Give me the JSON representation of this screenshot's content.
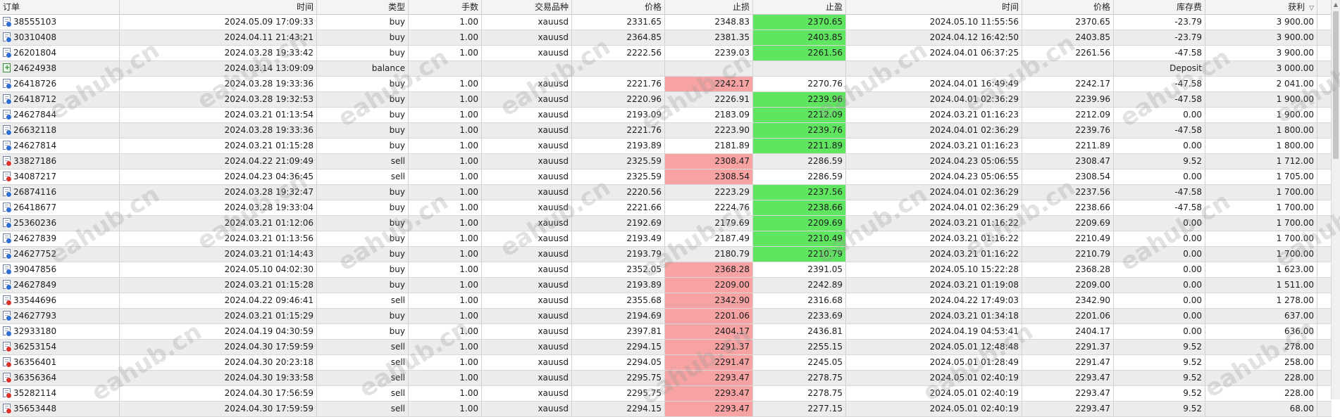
{
  "headers": {
    "order": "订单",
    "time": "时间",
    "type": "类型",
    "lots": "手数",
    "symbol": "交易品种",
    "price": "价格",
    "sl": "止损",
    "tp": "止盈",
    "close_time": "时间",
    "close_price": "价格",
    "swap": "库存费",
    "profit": "获利"
  },
  "watermark": "eahub.cn",
  "colors": {
    "tp_hit": "#5fe55f",
    "sl_hit": "#f7a3a3"
  },
  "rows": [
    {
      "order": "38555103",
      "time": "2024.05.09 17:09:33",
      "type": "buy",
      "lots": "1.00",
      "symbol": "xauusd",
      "price": "2331.65",
      "sl": "2348.83",
      "tp": "2370.65",
      "close_time": "2024.05.10 11:55:56",
      "close_price": "2370.65",
      "swap": "-23.79",
      "profit": "3 900.00",
      "hit": "tp"
    },
    {
      "order": "30310408",
      "time": "2024.04.11 21:43:21",
      "type": "buy",
      "lots": "1.00",
      "symbol": "xauusd",
      "price": "2364.85",
      "sl": "2381.35",
      "tp": "2403.85",
      "close_time": "2024.04.12 16:42:50",
      "close_price": "2403.85",
      "swap": "-23.79",
      "profit": "3 900.00",
      "hit": "tp"
    },
    {
      "order": "26201804",
      "time": "2024.03.28 19:33:42",
      "type": "buy",
      "lots": "1.00",
      "symbol": "xauusd",
      "price": "2222.56",
      "sl": "2239.03",
      "tp": "2261.56",
      "close_time": "2024.04.01 06:37:25",
      "close_price": "2261.56",
      "swap": "-47.58",
      "profit": "3 900.00",
      "hit": "tp"
    },
    {
      "order": "24624938",
      "time": "2024.03.14 13:09:09",
      "type": "balance",
      "lots": "",
      "symbol": "",
      "price": "",
      "sl": "",
      "tp": "",
      "close_time": "",
      "close_price": "",
      "swap": "Deposit",
      "profit": "3 000.00",
      "hit": ""
    },
    {
      "order": "26418726",
      "time": "2024.03.28 19:33:36",
      "type": "buy",
      "lots": "1.00",
      "symbol": "xauusd",
      "price": "2221.76",
      "sl": "2242.17",
      "tp": "2270.76",
      "close_time": "2024.04.01 16:49:49",
      "close_price": "2242.17",
      "swap": "-47.58",
      "profit": "2 041.00",
      "hit": "sl"
    },
    {
      "order": "26418712",
      "time": "2024.03.28 19:32:53",
      "type": "buy",
      "lots": "1.00",
      "symbol": "xauusd",
      "price": "2220.96",
      "sl": "2226.91",
      "tp": "2239.96",
      "close_time": "2024.04.01 02:36:29",
      "close_price": "2239.96",
      "swap": "-47.58",
      "profit": "1 900.00",
      "hit": "tp"
    },
    {
      "order": "24627844",
      "time": "2024.03.21 01:13:54",
      "type": "buy",
      "lots": "1.00",
      "symbol": "xauusd",
      "price": "2193.09",
      "sl": "2183.09",
      "tp": "2212.09",
      "close_time": "2024.03.21 01:16:23",
      "close_price": "2212.09",
      "swap": "0.00",
      "profit": "1 900.00",
      "hit": "tp"
    },
    {
      "order": "26632118",
      "time": "2024.03.28 19:33:36",
      "type": "buy",
      "lots": "1.00",
      "symbol": "xauusd",
      "price": "2221.76",
      "sl": "2223.90",
      "tp": "2239.76",
      "close_time": "2024.04.01 02:36:29",
      "close_price": "2239.76",
      "swap": "-47.58",
      "profit": "1 800.00",
      "hit": "tp"
    },
    {
      "order": "24627814",
      "time": "2024.03.21 01:15:28",
      "type": "buy",
      "lots": "1.00",
      "symbol": "xauusd",
      "price": "2193.89",
      "sl": "2181.89",
      "tp": "2211.89",
      "close_time": "2024.03.21 01:16:23",
      "close_price": "2211.89",
      "swap": "0.00",
      "profit": "1 800.00",
      "hit": "tp"
    },
    {
      "order": "33827186",
      "time": "2024.04.22 21:09:49",
      "type": "sell",
      "lots": "1.00",
      "symbol": "xauusd",
      "price": "2325.59",
      "sl": "2308.47",
      "tp": "2286.59",
      "close_time": "2024.04.23 05:06:55",
      "close_price": "2308.47",
      "swap": "9.52",
      "profit": "1 712.00",
      "hit": "sl"
    },
    {
      "order": "34087217",
      "time": "2024.04.23 04:36:45",
      "type": "sell",
      "lots": "1.00",
      "symbol": "xauusd",
      "price": "2325.59",
      "sl": "2308.54",
      "tp": "2286.59",
      "close_time": "2024.04.23 05:06:55",
      "close_price": "2308.54",
      "swap": "0.00",
      "profit": "1 705.00",
      "hit": "sl"
    },
    {
      "order": "26874116",
      "time": "2024.03.28 19:32:47",
      "type": "buy",
      "lots": "1.00",
      "symbol": "xauusd",
      "price": "2220.56",
      "sl": "2223.29",
      "tp": "2237.56",
      "close_time": "2024.04.01 02:36:29",
      "close_price": "2237.56",
      "swap": "-47.58",
      "profit": "1 700.00",
      "hit": "tp"
    },
    {
      "order": "26418677",
      "time": "2024.03.28 19:33:04",
      "type": "buy",
      "lots": "1.00",
      "symbol": "xauusd",
      "price": "2221.66",
      "sl": "2224.76",
      "tp": "2238.66",
      "close_time": "2024.04.01 02:36:29",
      "close_price": "2238.66",
      "swap": "-47.58",
      "profit": "1 700.00",
      "hit": "tp"
    },
    {
      "order": "25360236",
      "time": "2024.03.21 01:12:06",
      "type": "buy",
      "lots": "1.00",
      "symbol": "xauusd",
      "price": "2192.69",
      "sl": "2179.69",
      "tp": "2209.69",
      "close_time": "2024.03.21 01:16:22",
      "close_price": "2209.69",
      "swap": "0.00",
      "profit": "1 700.00",
      "hit": "tp"
    },
    {
      "order": "24627839",
      "time": "2024.03.21 01:13:56",
      "type": "buy",
      "lots": "1.00",
      "symbol": "xauusd",
      "price": "2193.49",
      "sl": "2187.49",
      "tp": "2210.49",
      "close_time": "2024.03.21 01:16:22",
      "close_price": "2210.49",
      "swap": "0.00",
      "profit": "1 700.00",
      "hit": "tp"
    },
    {
      "order": "24627752",
      "time": "2024.03.21 01:14:43",
      "type": "buy",
      "lots": "1.00",
      "symbol": "xauusd",
      "price": "2193.79",
      "sl": "2180.79",
      "tp": "2210.79",
      "close_time": "2024.03.21 01:16:22",
      "close_price": "2210.79",
      "swap": "0.00",
      "profit": "1 700.00",
      "hit": "tp"
    },
    {
      "order": "39047856",
      "time": "2024.05.10 04:02:30",
      "type": "buy",
      "lots": "1.00",
      "symbol": "xauusd",
      "price": "2352.05",
      "sl": "2368.28",
      "tp": "2391.05",
      "close_time": "2024.05.10 15:22:28",
      "close_price": "2368.28",
      "swap": "0.00",
      "profit": "1 623.00",
      "hit": "sl"
    },
    {
      "order": "24627849",
      "time": "2024.03.21 01:15:28",
      "type": "buy",
      "lots": "1.00",
      "symbol": "xauusd",
      "price": "2193.89",
      "sl": "2209.00",
      "tp": "2242.89",
      "close_time": "2024.03.21 01:19:08",
      "close_price": "2209.00",
      "swap": "0.00",
      "profit": "1 511.00",
      "hit": "sl"
    },
    {
      "order": "33544696",
      "time": "2024.04.22 09:46:41",
      "type": "sell",
      "lots": "1.00",
      "symbol": "xauusd",
      "price": "2355.68",
      "sl": "2342.90",
      "tp": "2316.68",
      "close_time": "2024.04.22 17:49:03",
      "close_price": "2342.90",
      "swap": "0.00",
      "profit": "1 278.00",
      "hit": "sl"
    },
    {
      "order": "24627793",
      "time": "2024.03.21 01:15:29",
      "type": "buy",
      "lots": "1.00",
      "symbol": "xauusd",
      "price": "2194.69",
      "sl": "2201.06",
      "tp": "2233.69",
      "close_time": "2024.03.21 01:34:18",
      "close_price": "2201.06",
      "swap": "0.00",
      "profit": "637.00",
      "hit": "sl"
    },
    {
      "order": "32933180",
      "time": "2024.04.19 04:30:59",
      "type": "buy",
      "lots": "1.00",
      "symbol": "xauusd",
      "price": "2397.81",
      "sl": "2404.17",
      "tp": "2436.81",
      "close_time": "2024.04.19 04:53:41",
      "close_price": "2404.17",
      "swap": "0.00",
      "profit": "636.00",
      "hit": "sl"
    },
    {
      "order": "36253154",
      "time": "2024.04.30 17:59:59",
      "type": "sell",
      "lots": "1.00",
      "symbol": "xauusd",
      "price": "2294.15",
      "sl": "2291.37",
      "tp": "2255.15",
      "close_time": "2024.05.01 12:48:48",
      "close_price": "2291.37",
      "swap": "9.52",
      "profit": "278.00",
      "hit": "sl"
    },
    {
      "order": "36356401",
      "time": "2024.04.30 20:23:18",
      "type": "sell",
      "lots": "1.00",
      "symbol": "xauusd",
      "price": "2294.05",
      "sl": "2291.47",
      "tp": "2245.05",
      "close_time": "2024.05.01 01:28:49",
      "close_price": "2291.47",
      "swap": "9.52",
      "profit": "258.00",
      "hit": "sl"
    },
    {
      "order": "36356364",
      "time": "2024.04.30 19:33:58",
      "type": "sell",
      "lots": "1.00",
      "symbol": "xauusd",
      "price": "2295.75",
      "sl": "2293.47",
      "tp": "2278.75",
      "close_time": "2024.05.01 02:40:19",
      "close_price": "2293.47",
      "swap": "9.52",
      "profit": "228.00",
      "hit": "sl"
    },
    {
      "order": "35282114",
      "time": "2024.04.30 17:56:59",
      "type": "sell",
      "lots": "1.00",
      "symbol": "xauusd",
      "price": "2295.75",
      "sl": "2293.47",
      "tp": "2278.75",
      "close_time": "2024.05.01 02:40:19",
      "close_price": "2293.47",
      "swap": "9.52",
      "profit": "228.00",
      "hit": "sl"
    },
    {
      "order": "35653448",
      "time": "2024.04.30 17:59:59",
      "type": "sell",
      "lots": "1.00",
      "symbol": "xauusd",
      "price": "2294.15",
      "sl": "2293.47",
      "tp": "2277.15",
      "close_time": "2024.05.01 02:40:19",
      "close_price": "2293.47",
      "swap": "9.52",
      "profit": "68.00",
      "hit": "sl"
    }
  ]
}
